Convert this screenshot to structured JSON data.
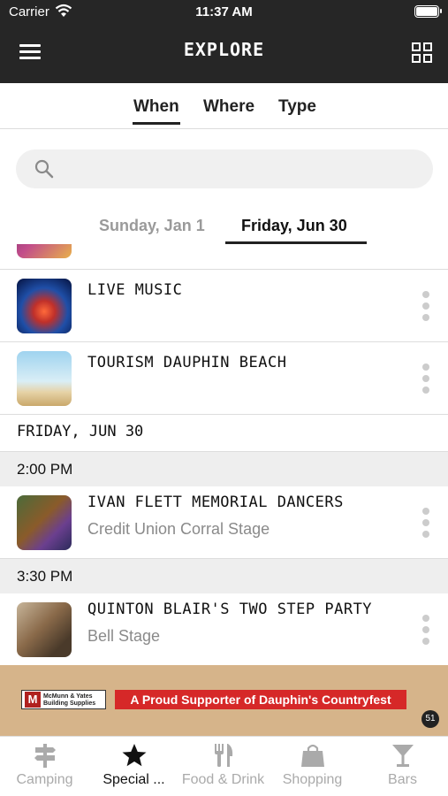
{
  "status_bar": {
    "carrier": "Carrier",
    "time": "11:37 AM"
  },
  "header": {
    "title": "EXPLORE",
    "menu_icon": "hamburger-menu-icon",
    "grid_icon": "grid-view-icon"
  },
  "segments": [
    {
      "label": "When",
      "active": true
    },
    {
      "label": "Where",
      "active": false
    },
    {
      "label": "Type",
      "active": false
    }
  ],
  "search": {
    "placeholder": "",
    "value": "",
    "icon": "search-icon"
  },
  "date_tabs": [
    {
      "label": "Sunday, Jan 1",
      "active": false
    },
    {
      "label": "Friday, Jun 30",
      "active": true
    }
  ],
  "list": {
    "events_before": [
      {
        "title": "LIVE MUSIC",
        "subtitle": ""
      },
      {
        "title": "TOURISM DAUPHIN BEACH",
        "subtitle": ""
      }
    ],
    "day_header": "FRIDAY, JUN 30",
    "time_groups": [
      {
        "time": "2:00 PM",
        "events": [
          {
            "title": "IVAN FLETT MEMORIAL DANCERS",
            "subtitle": "Credit Union Corral Stage"
          }
        ]
      },
      {
        "time": "3:30 PM",
        "events": [
          {
            "title": "QUINTON BLAIR'S TWO STEP PARTY",
            "subtitle": "Bell Stage"
          }
        ]
      }
    ]
  },
  "ad": {
    "banner_text": "A Proud Supporter of Dauphin's Countryfest",
    "logo_letter": "M",
    "logo_text_line1": "McMunn & Yates",
    "logo_text_line2": "Building Supplies",
    "badge": "51"
  },
  "tab_bar": [
    {
      "label": "Camping",
      "icon": "signpost-icon",
      "active": false
    },
    {
      "label": "Special ...",
      "icon": "star-icon",
      "active": true
    },
    {
      "label": "Food & Drink",
      "icon": "fork-knife-icon",
      "active": false
    },
    {
      "label": "Shopping",
      "icon": "shopping-bag-icon",
      "active": false
    },
    {
      "label": "Bars",
      "icon": "cocktail-glass-icon",
      "active": false
    }
  ],
  "colors": {
    "header_bg": "#262626",
    "accent": "#111111",
    "muted": "#8a8a8a",
    "ad_red": "#d62828"
  }
}
